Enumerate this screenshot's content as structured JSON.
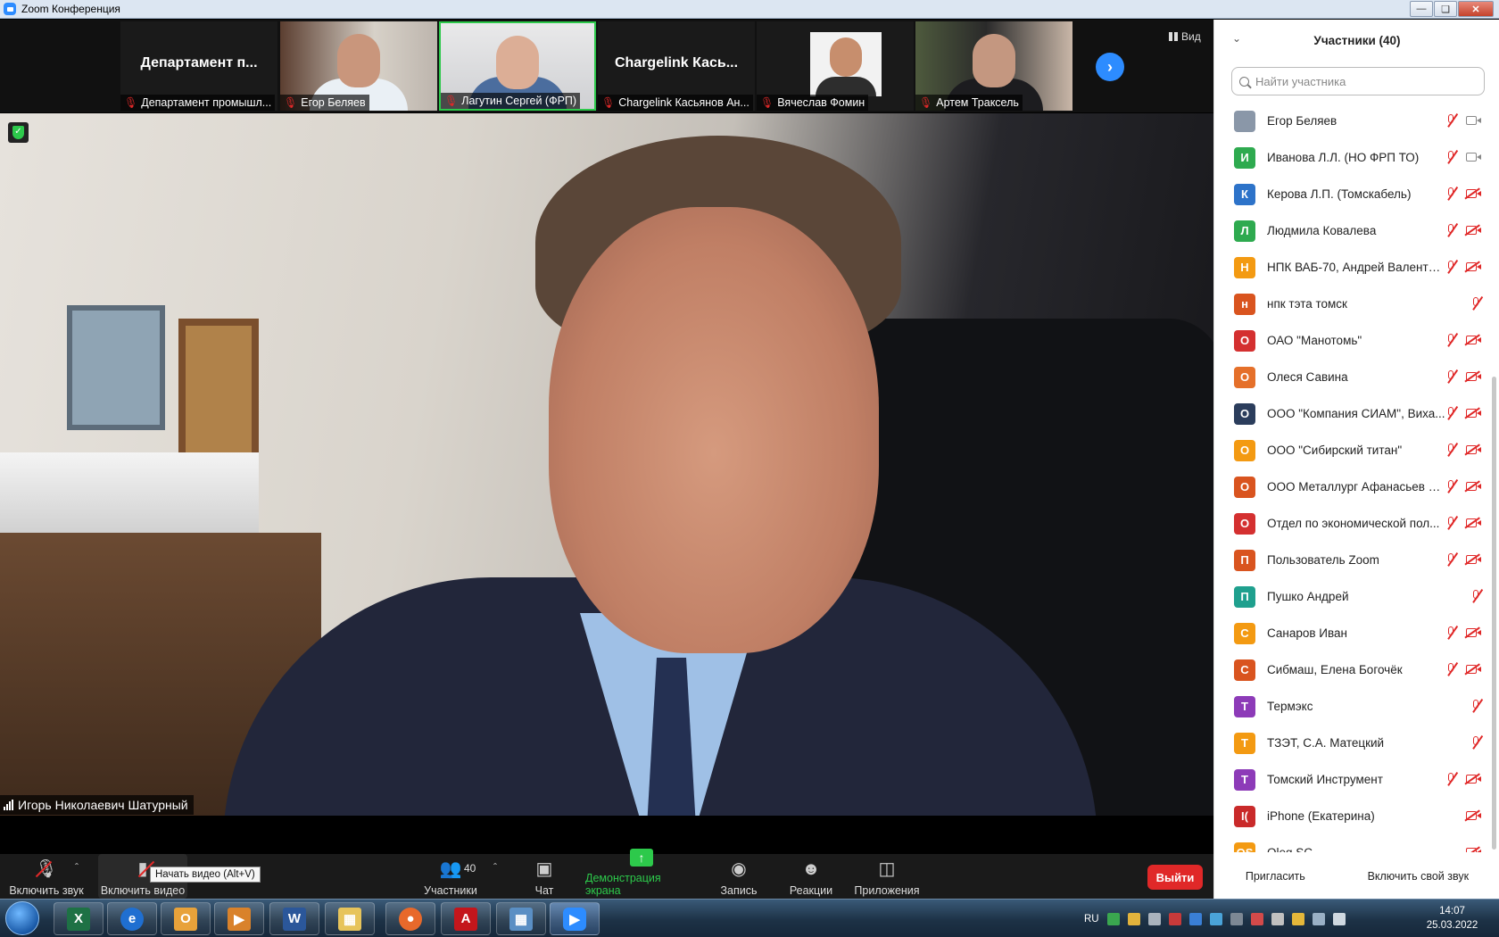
{
  "window": {
    "title": "Zoom Конференция"
  },
  "thumbnails": [
    {
      "big_name": "Департамент п...",
      "label": "Департамент промышл..."
    },
    {
      "label": "Егор Беляев"
    },
    {
      "label": "Лагутин Сергей (ФРП)"
    },
    {
      "big_name": "Chargelink  Кась...",
      "label": "Chargelink Касьянов Ан..."
    },
    {
      "label": "Вячеслав Фомин"
    },
    {
      "label": "Артем Траксель"
    }
  ],
  "view_button": "Вид",
  "speaker_name": "Игорь Николаевич Шатурный",
  "toolbar": {
    "unmute": "Включить звук",
    "start_video": "Включить видео",
    "participants": "Участники",
    "participants_count": "40",
    "chat": "Чат",
    "share_screen": "Демонстрация экрана",
    "record": "Запись",
    "reactions": "Реакции",
    "apps": "Приложения",
    "leave": "Выйти",
    "tooltip": "Начать видео (Alt+V)"
  },
  "panel": {
    "title": "Участники (40)",
    "search_placeholder": "Найти участника",
    "invite": "Пригласить",
    "unmute_me": "Включить свой звук",
    "participants": [
      {
        "initial": "",
        "name": "Егор Беляев",
        "color": "#8a97a8",
        "mic": "muted",
        "cam": "on"
      },
      {
        "initial": "И",
        "name": "Иванова Л.Л. (НО ФРП ТО)",
        "color": "#2eaa4f",
        "mic": "muted",
        "cam": "on"
      },
      {
        "initial": "К",
        "name": "Керова Л.П. (Томскабель)",
        "color": "#2d73c9",
        "mic": "muted",
        "cam": "off"
      },
      {
        "initial": "Л",
        "name": "Людмила Ковалева",
        "color": "#2eaa4f",
        "mic": "muted",
        "cam": "off"
      },
      {
        "initial": "Н",
        "name": "НПК ВАБ-70, Андрей Валентин...",
        "color": "#f39a12",
        "mic": "muted",
        "cam": "off"
      },
      {
        "initial": "н",
        "name": "нпк тэта томск",
        "color": "#d9541f",
        "mic": "muted",
        "cam": "none"
      },
      {
        "initial": "О",
        "name": "ОАО \"Манотомь\"",
        "color": "#d43030",
        "mic": "muted",
        "cam": "off"
      },
      {
        "initial": "О",
        "name": "Олеся Савина",
        "color": "#e5702a",
        "mic": "muted",
        "cam": "off"
      },
      {
        "initial": "О",
        "name": "ООО \"Компания СИАМ\", Виха...",
        "color": "#2b3d5c",
        "mic": "muted",
        "cam": "off"
      },
      {
        "initial": "О",
        "name": "ООО \"Сибирский титан\"",
        "color": "#f39a12",
        "mic": "muted",
        "cam": "off"
      },
      {
        "initial": "О",
        "name": "ООО Металлург Афанасьев В...",
        "color": "#d9541f",
        "mic": "muted",
        "cam": "off"
      },
      {
        "initial": "О",
        "name": "Отдел по экономической пол...",
        "color": "#d43030",
        "mic": "muted",
        "cam": "off"
      },
      {
        "initial": "П",
        "name": "Пользователь Zoom",
        "color": "#d9541f",
        "mic": "muted",
        "cam": "off"
      },
      {
        "initial": "П",
        "name": "Пушко Андрей",
        "color": "#1fa08e",
        "mic": "muted",
        "cam": "none"
      },
      {
        "initial": "С",
        "name": "Санаров Иван",
        "color": "#f39a12",
        "mic": "muted",
        "cam": "off"
      },
      {
        "initial": "С",
        "name": "Сибмаш, Елена Богочёк",
        "color": "#d9541f",
        "mic": "muted",
        "cam": "off"
      },
      {
        "initial": "Т",
        "name": "Термэкс",
        "color": "#8d3bb8",
        "mic": "muted",
        "cam": "none"
      },
      {
        "initial": "Т",
        "name": "ТЗЭТ, С.А. Матецкий",
        "color": "#f39a12",
        "mic": "muted",
        "cam": "none"
      },
      {
        "initial": "Т",
        "name": "Томский Инструмент",
        "color": "#8d3bb8",
        "mic": "muted",
        "cam": "off"
      },
      {
        "initial": "I(",
        "name": "iPhone (Екатерина)",
        "color": "#c92a2a",
        "mic": "none",
        "cam": "off"
      },
      {
        "initial": "OS",
        "name": "Oleg SC",
        "color": "#f39a12",
        "mic": "none",
        "cam": "off"
      }
    ]
  },
  "taskbar": {
    "language": "RU",
    "time": "14:07",
    "date": "25.03.2022"
  }
}
